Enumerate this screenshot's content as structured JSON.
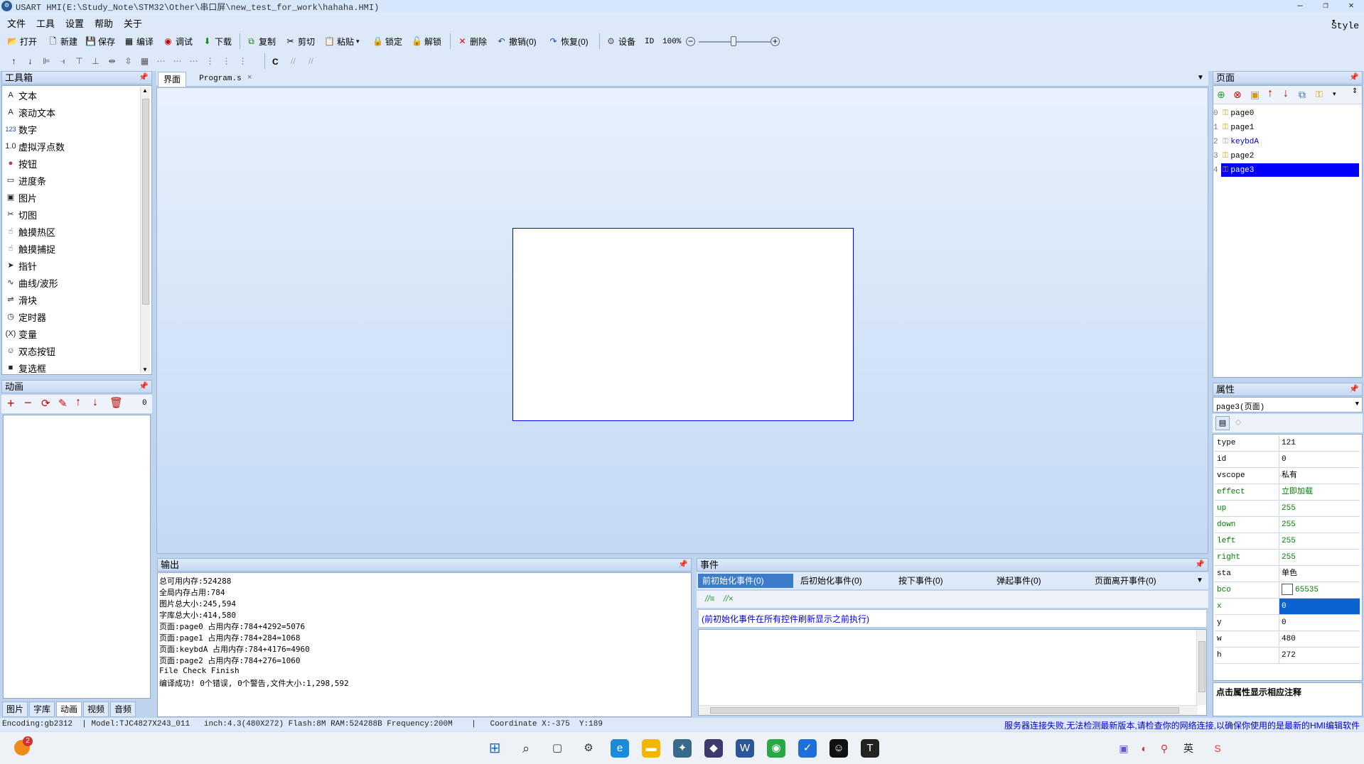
{
  "title": "USART  HMI(E:\\Study_Note\\STM32\\Other\\串口屏\\new_test_for_work\\hahaha.HMI)",
  "menu": [
    "文件",
    "工具",
    "设置",
    "帮助",
    "关于"
  ],
  "style_label": "Style",
  "toolbar1": {
    "open": "打开",
    "new": "新建",
    "save": "保存",
    "compile": "编译",
    "debug": "调试",
    "download": "下载",
    "copy": "复制",
    "cut": "剪切",
    "paste": "粘贴",
    "lock": "锁定",
    "unlock": "解锁",
    "delete": "删除",
    "undo": "撤销(0)",
    "redo": "恢复(0)",
    "settings": "设备",
    "id": "ID",
    "zoom": "100%"
  },
  "toolbar2_c": "C",
  "toolbox": {
    "title": "工具箱",
    "items": [
      {
        "icon": "A",
        "label": "文本"
      },
      {
        "icon": "A",
        "label": "滚动文本"
      },
      {
        "icon": "123",
        "label": "数字"
      },
      {
        "icon": "1.0",
        "label": "虚拟浮点数"
      },
      {
        "icon": "●",
        "label": "按钮"
      },
      {
        "icon": "▭",
        "label": "进度条"
      },
      {
        "icon": "▣",
        "label": "图片"
      },
      {
        "icon": "✂",
        "label": "切图"
      },
      {
        "icon": "☝",
        "label": "触摸热区"
      },
      {
        "icon": "☝",
        "label": "触摸捕捉"
      },
      {
        "icon": "➤",
        "label": "指针"
      },
      {
        "icon": "∿",
        "label": "曲线/波形"
      },
      {
        "icon": "⇌",
        "label": "滑块"
      },
      {
        "icon": "◷",
        "label": "定时器"
      },
      {
        "icon": "(X)",
        "label": "变量"
      },
      {
        "icon": "☺",
        "label": "双态按钮"
      },
      {
        "icon": "■",
        "label": "复选框"
      }
    ]
  },
  "animation": {
    "title": "动画",
    "count": "0",
    "tabs": [
      "图片",
      "字库",
      "动画",
      "视频",
      "音频"
    ]
  },
  "editor_tabs": [
    "界面",
    "Program.s"
  ],
  "output": {
    "title": "输出",
    "lines": [
      "总可用内存:524288",
      "全局内存占用:784",
      "图片总大小:245,594",
      "字库总大小:414,580",
      "页面:page0 占用内存:784+4292=5076",
      "页面:page1 占用内存:784+284=1068",
      "页面:keybdA 占用内存:784+4176=4960",
      "页面:page2 占用内存:784+276=1060",
      "File Check Finish",
      "编译成功! 0个错误, 0个警告,文件大小:1,298,592"
    ]
  },
  "events": {
    "title": "事件",
    "tabs": [
      "前初始化事件(0)",
      "后初始化事件(0)",
      "按下事件(0)",
      "弹起事件(0)",
      "页面离开事件(0)"
    ],
    "hint": "(前初始化事件在所有控件刷新显示之前执行)"
  },
  "pages": {
    "title": "页面",
    "items": [
      {
        "index": "0",
        "name": "page0",
        "selected": false
      },
      {
        "index": "1",
        "name": "page1",
        "selected": false
      },
      {
        "index": "2",
        "name": "keybdA",
        "selected": false
      },
      {
        "index": "3",
        "name": "page2",
        "selected": false
      },
      {
        "index": "4",
        "name": "page3",
        "selected": true
      }
    ]
  },
  "properties": {
    "title": "属性",
    "selector": "page3(页面)",
    "rows": [
      {
        "key": "type",
        "value": "121",
        "green": false
      },
      {
        "key": "id",
        "value": "0",
        "green": false
      },
      {
        "key": "vscope",
        "value": "私有",
        "green": false
      },
      {
        "key": "effect",
        "value": "立即加载",
        "green": true
      },
      {
        "key": "up",
        "value": "255",
        "green": true
      },
      {
        "key": "down",
        "value": "255",
        "green": true
      },
      {
        "key": "left",
        "value": "255",
        "green": true
      },
      {
        "key": "right",
        "value": "255",
        "green": true
      },
      {
        "key": "sta",
        "value": "单色",
        "green": false
      },
      {
        "key": "bco",
        "value": "65535",
        "green": true
      },
      {
        "key": "x",
        "value": "0",
        "green": true
      },
      {
        "key": "y",
        "value": "0",
        "green": false
      },
      {
        "key": "w",
        "value": "480",
        "green": false
      },
      {
        "key": "h",
        "value": "272",
        "green": false
      }
    ],
    "footer": "点击属性显示相应注释"
  },
  "status": {
    "left": "Encoding:gb2312  | Model:TJC4827X243_011   inch:4.3(480X272) Flash:8M RAM:524288B Frequency:200M    |   Coordinate X:-375  Y:189",
    "right": "服务器连接失败,无法检测最新版本,请检查你的网络连接,以确保你使用的是最新的HMI编辑软件"
  },
  "taskbar": {
    "ime": "英",
    "badge": "2"
  },
  "colors": {
    "accent": "#0000ff",
    "selection": "#0a63d1",
    "canvas": "#c7ddf7",
    "panel": "#dde9f8",
    "green_text": "#008000"
  }
}
